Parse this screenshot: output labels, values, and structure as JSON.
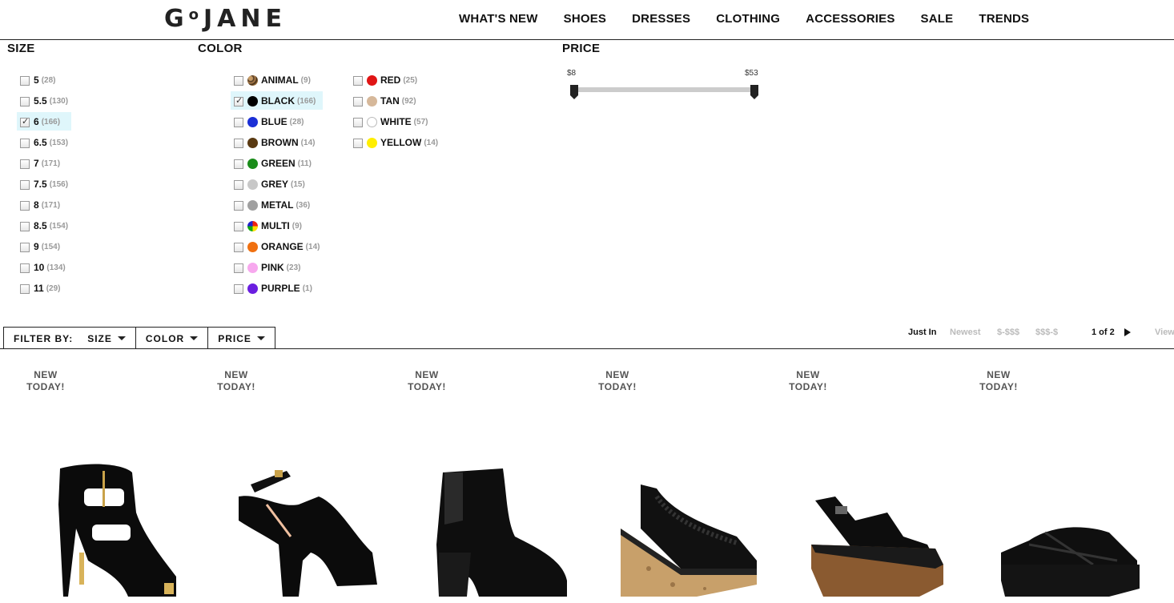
{
  "header": {
    "logo": "GoJANE",
    "nav": [
      "WHAT'S NEW",
      "SHOES",
      "DRESSES",
      "CLOTHING",
      "ACCESSORIES",
      "SALE",
      "TRENDS"
    ]
  },
  "filters": {
    "size": {
      "title": "SIZE",
      "options": [
        {
          "label": "5",
          "count": "(28)",
          "checked": false
        },
        {
          "label": "5.5",
          "count": "(130)",
          "checked": false
        },
        {
          "label": "6",
          "count": "(166)",
          "checked": true
        },
        {
          "label": "6.5",
          "count": "(153)",
          "checked": false
        },
        {
          "label": "7",
          "count": "(171)",
          "checked": false
        },
        {
          "label": "7.5",
          "count": "(156)",
          "checked": false
        },
        {
          "label": "8",
          "count": "(171)",
          "checked": false
        },
        {
          "label": "8.5",
          "count": "(154)",
          "checked": false
        },
        {
          "label": "9",
          "count": "(154)",
          "checked": false
        },
        {
          "label": "10",
          "count": "(134)",
          "checked": false
        },
        {
          "label": "11",
          "count": "(29)",
          "checked": false
        }
      ]
    },
    "color": {
      "title": "COLOR",
      "col1": [
        {
          "label": "ANIMAL",
          "count": "(9)",
          "swatch": "animal",
          "checked": false
        },
        {
          "label": "BLACK",
          "count": "(166)",
          "swatch": "#000000",
          "checked": true
        },
        {
          "label": "BLUE",
          "count": "(28)",
          "swatch": "#1b2fd6",
          "checked": false
        },
        {
          "label": "BROWN",
          "count": "(14)",
          "swatch": "#5a3a12",
          "checked": false
        },
        {
          "label": "GREEN",
          "count": "(11)",
          "swatch": "#1a8c1a",
          "checked": false
        },
        {
          "label": "GREY",
          "count": "(15)",
          "swatch": "#c8c8c8",
          "checked": false
        },
        {
          "label": "METAL",
          "count": "(36)",
          "swatch": "#a0a0a0",
          "checked": false
        },
        {
          "label": "MULTI",
          "count": "(9)",
          "swatch": "multi",
          "checked": false
        },
        {
          "label": "ORANGE",
          "count": "(14)",
          "swatch": "#f07010",
          "checked": false
        },
        {
          "label": "PINK",
          "count": "(23)",
          "swatch": "#f7a8ee",
          "checked": false
        },
        {
          "label": "PURPLE",
          "count": "(1)",
          "swatch": "#6a1ee0",
          "checked": false
        }
      ],
      "col2": [
        {
          "label": "RED",
          "count": "(25)",
          "swatch": "#e01515",
          "checked": false
        },
        {
          "label": "TAN",
          "count": "(92)",
          "swatch": "#d6b89a",
          "checked": false
        },
        {
          "label": "WHITE",
          "count": "(57)",
          "swatch": "white",
          "checked": false
        },
        {
          "label": "YELLOW",
          "count": "(14)",
          "swatch": "#ffee00",
          "checked": false
        }
      ]
    },
    "price": {
      "title": "PRICE",
      "min_label": "$8",
      "max_label": "$53"
    }
  },
  "toolbar": {
    "filter_by": "FILTER BY:",
    "size": "SIZE",
    "color": "COLOR",
    "price": "PRICE",
    "sort": {
      "just_in": "Just In",
      "newest": "Newest",
      "low_high": "$-$$$",
      "high_low": "$$$-$"
    },
    "pagination": "1 of 2",
    "view": "View"
  },
  "products": [
    {
      "badge_line1": "NEW",
      "badge_line2": "TODAY!",
      "icon": "cutout-zip-heel-icon"
    },
    {
      "badge_line1": "NEW",
      "badge_line2": "TODAY!",
      "icon": "strappy-platform-heel-icon"
    },
    {
      "badge_line1": "NEW",
      "badge_line2": "TODAY!",
      "icon": "chelsea-bootie-icon"
    },
    {
      "badge_line1": "NEW",
      "badge_line2": "TODAY!",
      "icon": "lace-cork-wedge-icon"
    },
    {
      "badge_line1": "NEW",
      "badge_line2": "TODAY!",
      "icon": "strappy-wood-wedge-icon"
    },
    {
      "badge_line1": "NEW",
      "badge_line2": "TODAY!",
      "icon": "crisscross-wedge-slide-icon"
    }
  ]
}
